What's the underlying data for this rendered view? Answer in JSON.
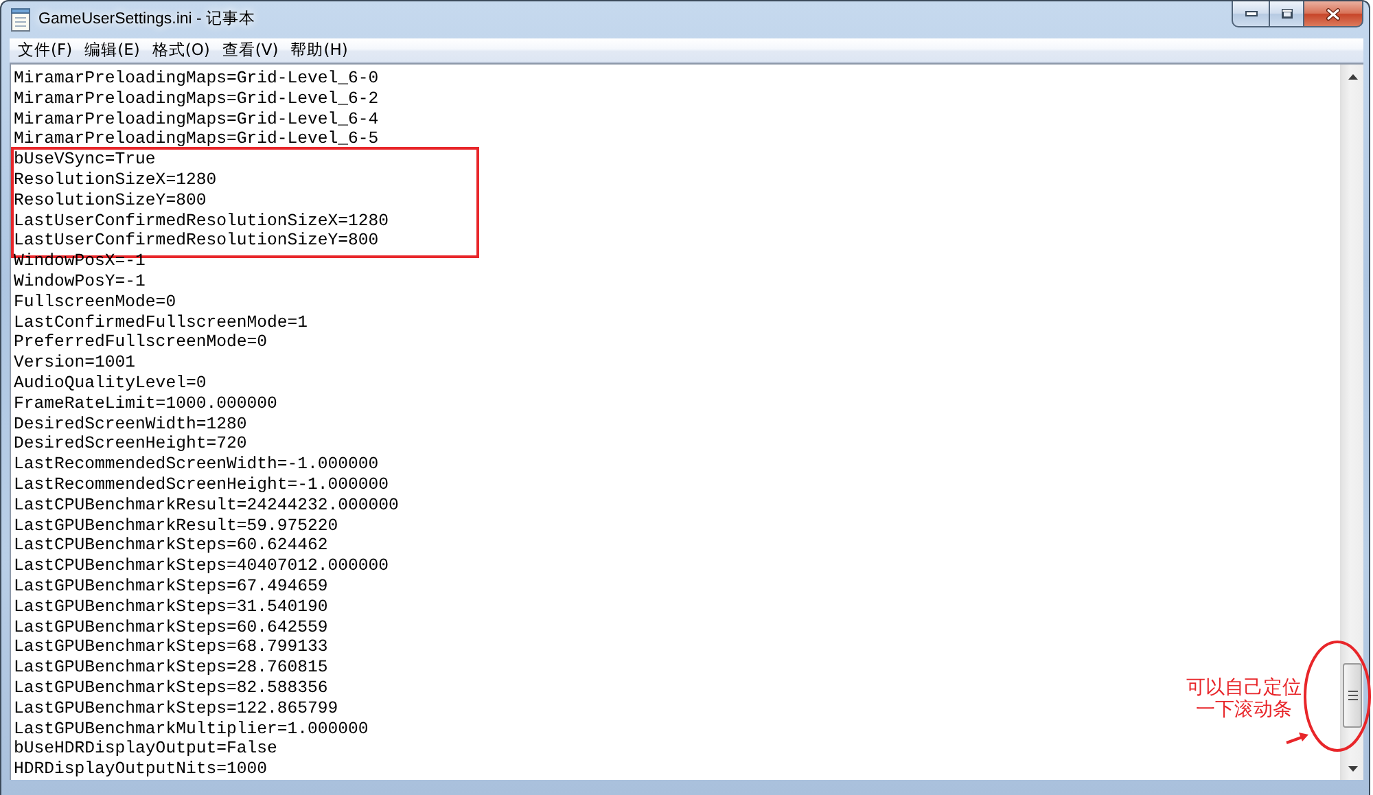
{
  "window": {
    "title": "GameUserSettings.ini - 记事本"
  },
  "menu_bar": [
    "文件(F)",
    "编辑(E)",
    "格式(O)",
    "查看(V)",
    "帮助(H)"
  ],
  "editor": {
    "lines": [
      {
        "text": "MiramarPreloadingMaps=Grid-Level_6-0",
        "highlighted": false
      },
      {
        "text": "MiramarPreloadingMaps=Grid-Level_6-2",
        "highlighted": false
      },
      {
        "text": "MiramarPreloadingMaps=Grid-Level_6-4",
        "highlighted": false
      },
      {
        "text": "MiramarPreloadingMaps=Grid-Level_6-5",
        "highlighted": false
      },
      {
        "text": "bUseVSync=True",
        "highlighted": true
      },
      {
        "text": "ResolutionSizeX=1280",
        "highlighted": true
      },
      {
        "text": "ResolutionSizeY=800",
        "highlighted": true
      },
      {
        "text": "LastUserConfirmedResolutionSizeX=1280",
        "highlighted": true
      },
      {
        "text": "LastUserConfirmedResolutionSizeY=800",
        "highlighted": true
      },
      {
        "text": "WindowPosX=-1",
        "highlighted": false
      },
      {
        "text": "WindowPosY=-1",
        "highlighted": false
      },
      {
        "text": "FullscreenMode=0",
        "highlighted": false
      },
      {
        "text": "LastConfirmedFullscreenMode=1",
        "highlighted": false
      },
      {
        "text": "PreferredFullscreenMode=0",
        "highlighted": false
      },
      {
        "text": "Version=1001",
        "highlighted": false
      },
      {
        "text": "AudioQualityLevel=0",
        "highlighted": false
      },
      {
        "text": "FrameRateLimit=1000.000000",
        "highlighted": false
      },
      {
        "text": "DesiredScreenWidth=1280",
        "highlighted": false
      },
      {
        "text": "DesiredScreenHeight=720",
        "highlighted": false
      },
      {
        "text": "LastRecommendedScreenWidth=-1.000000",
        "highlighted": false
      },
      {
        "text": "LastRecommendedScreenHeight=-1.000000",
        "highlighted": false
      },
      {
        "text": "LastCPUBenchmarkResult=24244232.000000",
        "highlighted": false
      },
      {
        "text": "LastGPUBenchmarkResult=59.975220",
        "highlighted": false
      },
      {
        "text": "LastCPUBenchmarkSteps=60.624462",
        "highlighted": false
      },
      {
        "text": "LastCPUBenchmarkSteps=40407012.000000",
        "highlighted": false
      },
      {
        "text": "LastGPUBenchmarkSteps=67.494659",
        "highlighted": false
      },
      {
        "text": "LastGPUBenchmarkSteps=31.540190",
        "highlighted": false
      },
      {
        "text": "LastGPUBenchmarkSteps=60.642559",
        "highlighted": false
      },
      {
        "text": "LastGPUBenchmarkSteps=68.799133",
        "highlighted": false
      },
      {
        "text": "LastGPUBenchmarkSteps=28.760815",
        "highlighted": false
      },
      {
        "text": "LastGPUBenchmarkSteps=82.588356",
        "highlighted": false
      },
      {
        "text": "LastGPUBenchmarkSteps=122.865799",
        "highlighted": false
      },
      {
        "text": "LastGPUBenchmarkMultiplier=1.000000",
        "highlighted": false
      },
      {
        "text": "bUseHDRDisplayOutput=False",
        "highlighted": false
      },
      {
        "text": "HDRDisplayOutputNits=1000",
        "highlighted": false
      }
    ]
  },
  "annotation": {
    "lines": [
      "可以自己定位",
      "一下滚动条"
    ]
  }
}
